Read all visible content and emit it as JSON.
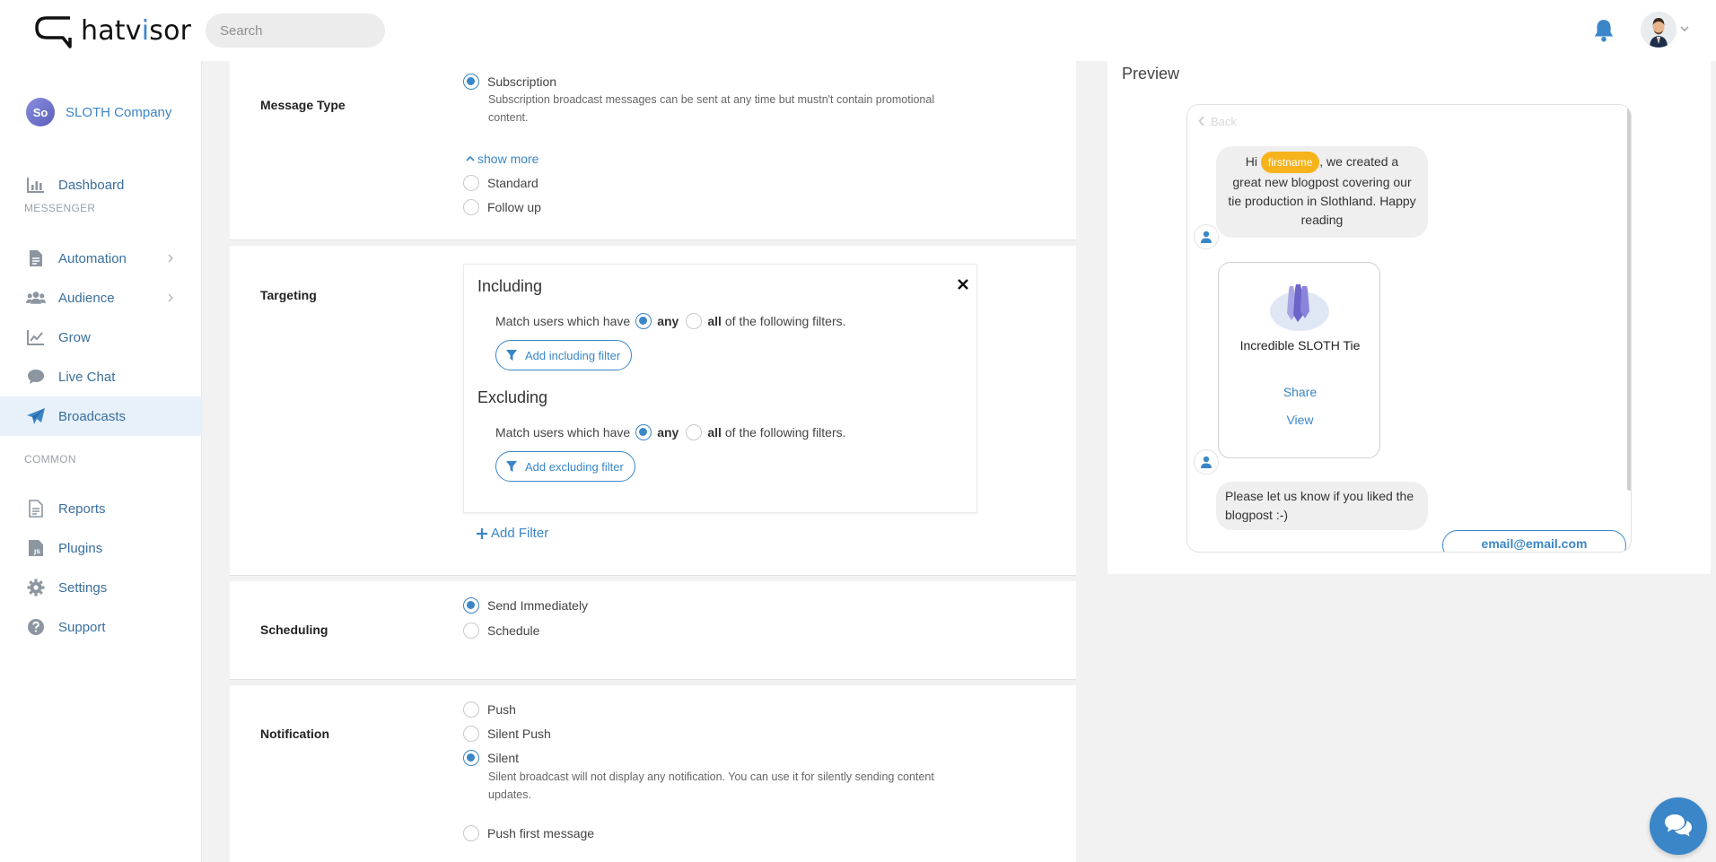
{
  "app": {
    "logo_text_pre": "hatv",
    "logo_text_i": "i",
    "logo_text_post": "sor"
  },
  "search": {
    "placeholder": "Search"
  },
  "sidebar": {
    "company": {
      "initials": "So",
      "name": "SLOTH Company"
    },
    "items": [
      {
        "label": "Dashboard",
        "icon": "bar-chart-icon"
      },
      {
        "label": "Automation",
        "icon": "document-icon"
      },
      {
        "label": "Audience",
        "icon": "users-icon"
      },
      {
        "label": "Grow",
        "icon": "trend-icon"
      },
      {
        "label": "Live Chat",
        "icon": "chat-bubble-icon"
      },
      {
        "label": "Broadcasts",
        "icon": "paper-plane-icon"
      },
      {
        "label": "Reports",
        "icon": "report-icon"
      },
      {
        "label": "Plugins",
        "icon": "plugin-js-icon"
      },
      {
        "label": "Settings",
        "icon": "gear-icon"
      },
      {
        "label": "Support",
        "icon": "question-icon"
      }
    ],
    "sections": {
      "messenger": "MESSENGER",
      "common": "COMMON"
    }
  },
  "message_type": {
    "label": "Message Type",
    "options": {
      "subscription": "Subscription",
      "standard": "Standard",
      "follow_up": "Follow up"
    },
    "subscription_help": "Subscription broadcast messages can be sent at any time but mustn't contain promotional content.",
    "show_more": "show more"
  },
  "targeting": {
    "label": "Targeting",
    "including": {
      "title": "Including",
      "match_prefix": "Match users which have",
      "any": "any",
      "all": "all",
      "match_suffix": "of the following filters.",
      "button": "Add including filter"
    },
    "excluding": {
      "title": "Excluding",
      "match_prefix": "Match users which have",
      "any": "any",
      "all": "all",
      "match_suffix": "of the following filters.",
      "button": "Add excluding filter"
    },
    "add_filter": "Add Filter"
  },
  "scheduling": {
    "label": "Scheduling",
    "options": {
      "send_immediately": "Send Immediately",
      "schedule": "Schedule"
    }
  },
  "notification": {
    "label": "Notification",
    "options": {
      "push": "Push",
      "silent_push": "Silent Push",
      "silent": "Silent",
      "push_first": "Push first message"
    },
    "silent_help": "Silent broadcast will not display any notification. You can use it for silently sending content updates."
  },
  "preview": {
    "title": "Preview",
    "back": "Back",
    "msg1_pre": "Hi",
    "msg1_tag": "firstname",
    "msg1_line1": ", we created a",
    "msg1_line2": "great new blogpost covering our",
    "msg1_line3": "tie production in Slothland. Happy",
    "msg1_line4": "reading",
    "product_title": "Incredible SLOTH Tie",
    "share": "Share",
    "view": "View",
    "msg2_line1": "Please let us know if you liked the",
    "msg2_line2": "blogpost :-)",
    "email_button": "email@email.com"
  },
  "colors": {
    "accent": "#3a86c8",
    "tag": "#f6b31c",
    "active_bg": "#e8f1f9"
  }
}
